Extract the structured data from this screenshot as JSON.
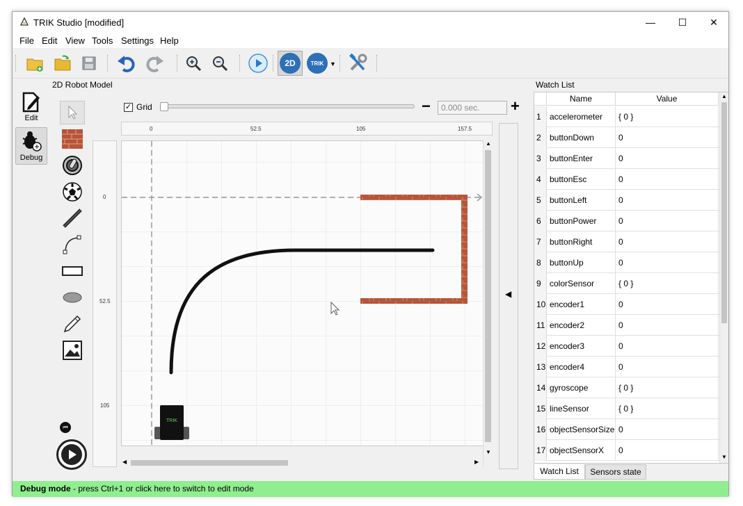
{
  "window": {
    "title": "TRIK Studio [modified]",
    "minimize": "—",
    "maximize": "☐",
    "close": "✕"
  },
  "menu": [
    "File",
    "Edit",
    "View",
    "Tools",
    "Settings",
    "Help"
  ],
  "toolbar": {
    "buttons": [
      "new-project-icon",
      "open-project-icon",
      "save-icon",
      "undo-icon",
      "redo-icon",
      "zoom-in-icon",
      "zoom-out-icon",
      "run-icon",
      "2d-model-icon",
      "trik-robot-icon",
      "settings-tools-icon"
    ],
    "mode_2d_label": "2D",
    "trik_label": "TRIK"
  },
  "modes": {
    "edit_label": "Edit",
    "debug_label": "Debug"
  },
  "model_panel": {
    "title": "2D Robot Model",
    "grid_label": "Grid",
    "grid_checked": true,
    "speed_minus": "−",
    "speed_plus": "+",
    "time_value": "0.000 sec.",
    "hruler_labels": [
      "0",
      "52.5",
      "105",
      "157.5"
    ],
    "vruler_labels": [
      "0",
      "52.5",
      "105"
    ],
    "robot_label": "TRIK"
  },
  "palette": [
    "cursor-tool-icon",
    "wall-tool-icon",
    "skittle-tool-icon",
    "ball-tool-icon",
    "line-tool-icon",
    "bezier-tool-icon",
    "rectangle-tool-icon",
    "ellipse-tool-icon",
    "pencil-tool-icon",
    "image-tool-icon"
  ],
  "watch_list": {
    "title": "Watch List",
    "col_name": "Name",
    "col_value": "Value",
    "rows": [
      {
        "n": "1",
        "name": "accelerometer",
        "value": "{ 0 }"
      },
      {
        "n": "2",
        "name": "buttonDown",
        "value": "0"
      },
      {
        "n": "3",
        "name": "buttonEnter",
        "value": "0"
      },
      {
        "n": "4",
        "name": "buttonEsc",
        "value": "0"
      },
      {
        "n": "5",
        "name": "buttonLeft",
        "value": "0"
      },
      {
        "n": "6",
        "name": "buttonPower",
        "value": "0"
      },
      {
        "n": "7",
        "name": "buttonRight",
        "value": "0"
      },
      {
        "n": "8",
        "name": "buttonUp",
        "value": "0"
      },
      {
        "n": "9",
        "name": "colorSensor",
        "value": "{ 0 }"
      },
      {
        "n": "10",
        "name": "encoder1",
        "value": "0"
      },
      {
        "n": "11",
        "name": "encoder2",
        "value": "0"
      },
      {
        "n": "12",
        "name": "encoder3",
        "value": "0"
      },
      {
        "n": "13",
        "name": "encoder4",
        "value": "0"
      },
      {
        "n": "14",
        "name": "gyroscope",
        "value": "{ 0 }"
      },
      {
        "n": "15",
        "name": "lineSensor",
        "value": "{ 0 }"
      },
      {
        "n": "16",
        "name": "objectSensorSize",
        "value": "0"
      },
      {
        "n": "17",
        "name": "objectSensorX",
        "value": "0"
      }
    ],
    "tabs": [
      "Watch List",
      "Sensors state"
    ]
  },
  "status": {
    "bold": "Debug mode",
    "text": " - press Ctrl+1 or click here to switch to edit mode"
  },
  "colors": {
    "status_bg": "#90ee90",
    "wall": "#b5553b",
    "accent_blue": "#1e78c8"
  }
}
